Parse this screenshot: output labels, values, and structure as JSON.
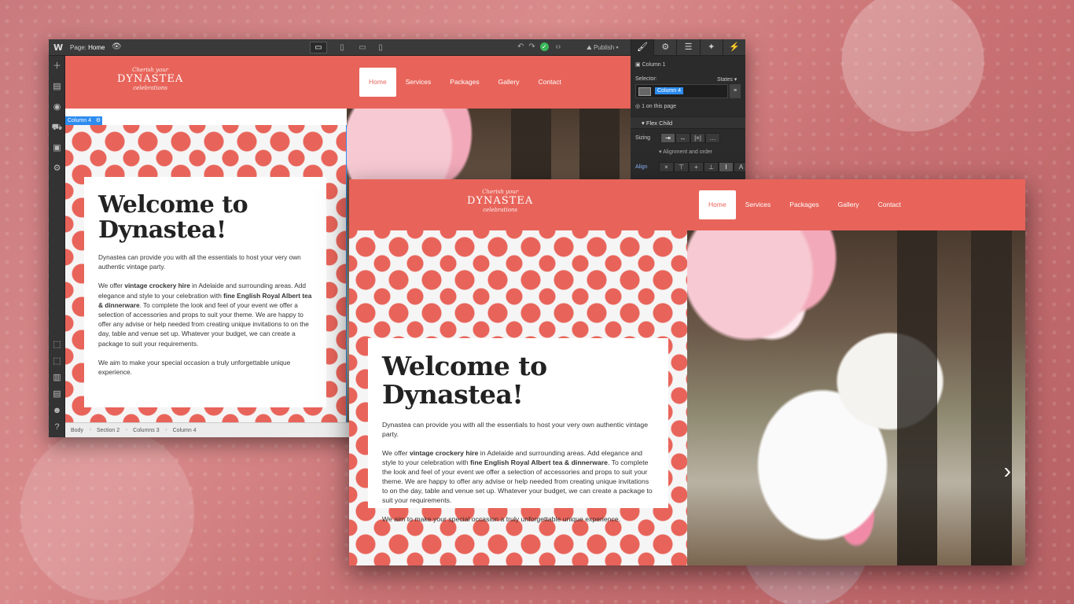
{
  "editor": {
    "logo": "W",
    "page_label": "Page:",
    "page_name": "Home",
    "publish": "Publish",
    "selected_badge": "Column 4",
    "breadcrumb": [
      "Body",
      "Section 2",
      "Columns 3",
      "Column 4"
    ]
  },
  "panel": {
    "element_name": "Column 1",
    "selector_label": "Selector:",
    "states_label": "States",
    "selector_tag": "Column 4",
    "on_page": "1 on this page",
    "section_flex": "Flex Child",
    "sizing_label": "Sizing",
    "alignment_order": "Alignment and order",
    "align_label": "Align"
  },
  "site": {
    "brand_script_top": "Cherish your",
    "brand_name": "DYNASTEA",
    "brand_script_bottom": "celebrations",
    "nav": [
      "Home",
      "Services",
      "Packages",
      "Gallery",
      "Contact"
    ],
    "heading": "Welcome to Dynastea!",
    "p1": "Dynastea can provide you with all the essentials to host your very own authentic vintage party.",
    "p2_a": "We offer ",
    "p2_b": "vintage crockery hire",
    "p2_c": " in Adelaide and surrounding areas. Add elegance and style to your celebration with ",
    "p2_d": "fine English Royal Albert tea & dinnerware",
    "p2_e": ". To complete the look and feel of your event we offer a selection of accessories and props to suit your theme. We are happy to offer any advise or help needed from creating unique invitations to on the day, table and venue set up. Whatever your budget, we can create a package to suit your requirements.",
    "p3": "We aim to make your special occasion a truly unforgettable unique experience."
  },
  "colors": {
    "brand": "#e8645a",
    "selection": "#2d8cf0",
    "publish_ok": "#3bb55a"
  },
  "icons": [
    "add-icon",
    "pages-icon",
    "cms-icon",
    "ecommerce-icon",
    "assets-icon",
    "settings-icon",
    "style-brush-icon",
    "gear-icon",
    "navigator-icon",
    "interactions-icon",
    "lightning-icon",
    "undo-icon",
    "redo-icon",
    "code-icon",
    "desktop-icon",
    "tablet-icon",
    "mobile-landscape-icon",
    "mobile-icon",
    "chevron-right-icon"
  ]
}
